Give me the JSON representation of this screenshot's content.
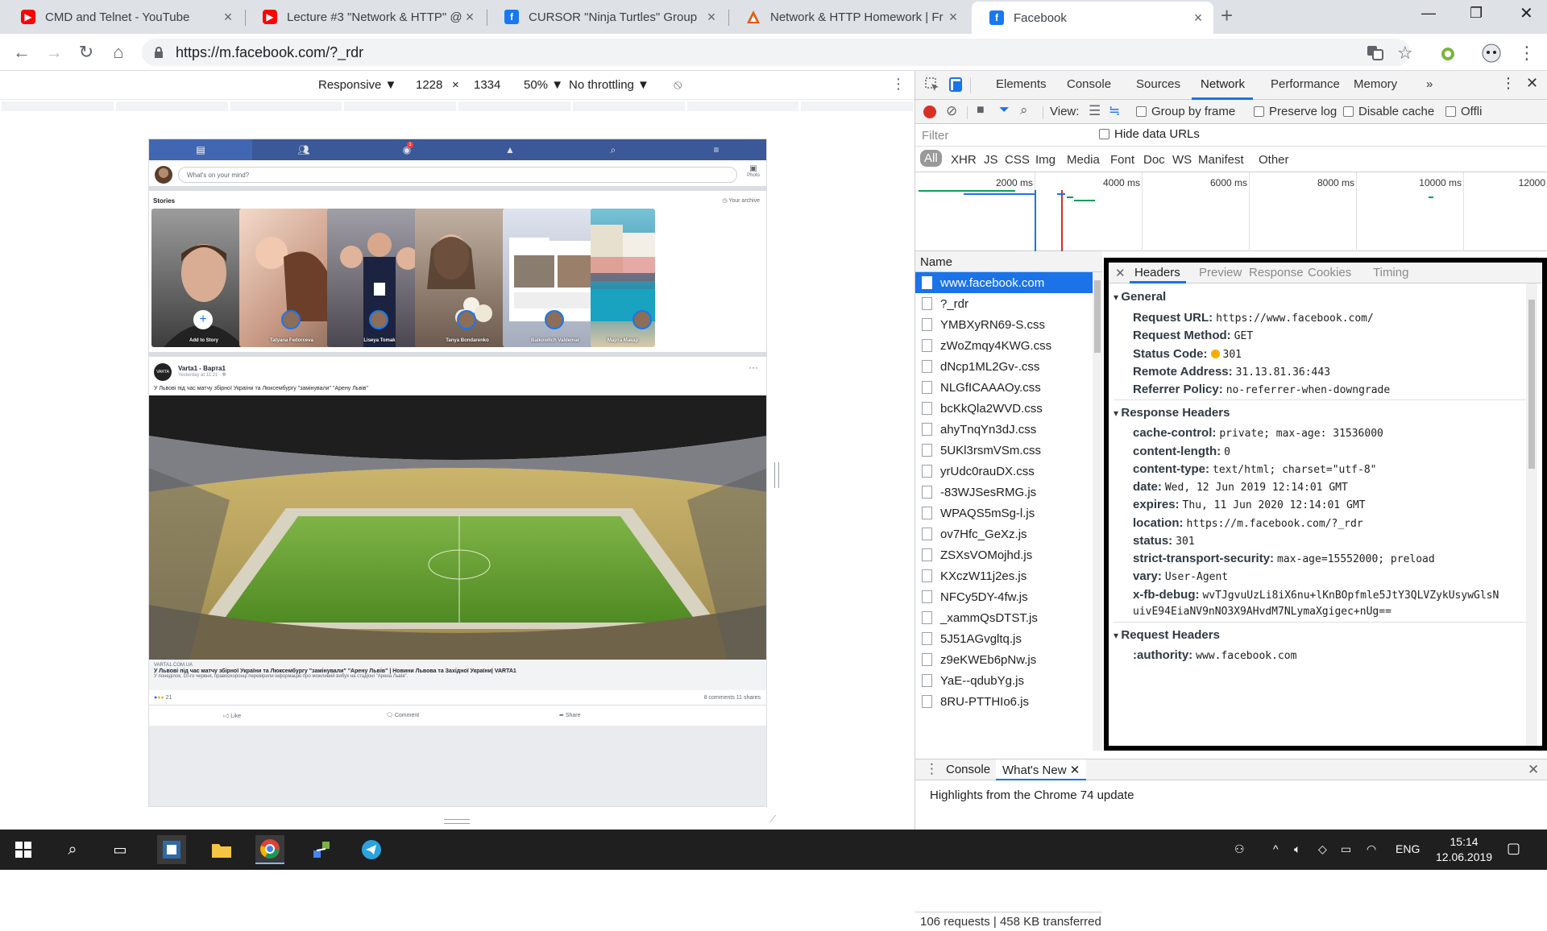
{
  "tabs": [
    {
      "title": "CMD and Telnet - YouTube",
      "favicon": "youtube-icon"
    },
    {
      "title": "Lecture #3 \"Network & HTTP\" @",
      "favicon": "youtube-icon"
    },
    {
      "title": "CURSOR \"Ninja Turtles\" Group",
      "favicon": "facebook-icon"
    },
    {
      "title": "Network & HTTP Homework | Fr",
      "favicon": "warning-triangle-icon"
    },
    {
      "title": "Facebook",
      "favicon": "facebook-icon"
    }
  ],
  "omnibox": {
    "url": "https://m.facebook.com/?_rdr"
  },
  "device_toolbar": {
    "mode": "Responsive ▼",
    "width": "1228",
    "times": "×",
    "height": "1334",
    "zoom": "50% ▼",
    "throttling": "No throttling ▼"
  },
  "fb": {
    "composer_placeholder": "What's on your mind?",
    "photo_label": "Photo",
    "stories_title": "Stories",
    "archive_label": "Your archive",
    "stories": [
      {
        "name": "Add to Story"
      },
      {
        "name": "Tatyana Fedorceva"
      },
      {
        "name": "Liseya Tomak"
      },
      {
        "name": "Tanya Bondarenko"
      },
      {
        "name": "Balkowitch Valdemar"
      },
      {
        "name": "Марта Макар"
      }
    ],
    "post_author": "Varta1 - Варта1",
    "post_time": "Yesterday at 11:21 · ",
    "post_text": "У Львові під час матчу збірної України та Люксембургу \"замінували\" \"Арену Львів\"",
    "link_domain": "VARTA1.COM.UA",
    "link_title": "У Львові під час матчу збірної України та Люксембургу \"замінували\" \"Арену Львів\" | Новини Львова та Західної України| VARTA1",
    "link_desc": "У понеділок, 10-го червня, правоохоронці перевірили інформацію про можливий вибух на стадіоні \"Арена Львів\".",
    "reaction_count": "21",
    "counts": "8 comments   11 shares",
    "like": "Like",
    "comment": "Comment",
    "share": "Share"
  },
  "devtools": {
    "tabs": [
      "Elements",
      "Console",
      "Sources",
      "Network",
      "Performance",
      "Memory",
      "»"
    ],
    "view_label": "View:",
    "group_by_frame": "Group by frame",
    "preserve_log": "Preserve log",
    "disable_cache": "Disable cache",
    "offline": "Offli",
    "filter_placeholder": "Filter",
    "hide_data_urls": "Hide data URLs",
    "types": [
      "All",
      "XHR",
      "JS",
      "CSS",
      "Img",
      "Media",
      "Font",
      "Doc",
      "WS",
      "Manifest",
      "Other"
    ],
    "timeline_labels": [
      "2000 ms",
      "4000 ms",
      "6000 ms",
      "8000 ms",
      "10000 ms",
      "12000"
    ],
    "name_header": "Name",
    "requests": [
      "www.facebook.com",
      "?_rdr",
      "YMBXyRN69-S.css",
      "zWoZmqy4KWG.css",
      "dNcp1ML2Gv-.css",
      "NLGfICAAAOy.css",
      "bcKkQla2WVD.css",
      "ahyTnqYn3dJ.css",
      "5UKl3rsmVSm.css",
      "yrUdc0rauDX.css",
      "-83WJSesRMG.js",
      "WPAQS5mSg-l.js",
      "ov7Hfc_GeXz.js",
      "ZSXsVOMojhd.js",
      "KXczW11j2es.js",
      "NFCy5DY-4fw.js",
      "_xammQsDTST.js",
      "5J51AGvgltq.js",
      "z9eKWEb6pNw.js",
      "YaE--qdubYg.js",
      "8RU-PTTHIo6.js"
    ],
    "summary": "106 requests | 458 KB transferred...",
    "detail_tabs": [
      "Headers",
      "Preview",
      "Response",
      "Cookies",
      "Timing"
    ],
    "general_title": "General",
    "general": [
      {
        "k": "Request URL:",
        "v": "https://www.facebook.com/"
      },
      {
        "k": "Request Method:",
        "v": "GET"
      },
      {
        "k": "Status Code:",
        "v": "301"
      },
      {
        "k": "Remote Address:",
        "v": "31.13.81.36:443"
      },
      {
        "k": "Referrer Policy:",
        "v": "no-referrer-when-downgrade"
      }
    ],
    "response_title": "Response Headers",
    "response": [
      {
        "k": "cache-control:",
        "v": "private; max-age: 31536000"
      },
      {
        "k": "content-length:",
        "v": "0"
      },
      {
        "k": "content-type:",
        "v": "text/html; charset=\"utf-8\""
      },
      {
        "k": "date:",
        "v": "Wed, 12 Jun 2019 12:14:01 GMT"
      },
      {
        "k": "expires:",
        "v": "Thu, 11 Jun 2020 12:14:01 GMT"
      },
      {
        "k": "location:",
        "v": "https://m.facebook.com/?_rdr"
      },
      {
        "k": "status:",
        "v": "301"
      },
      {
        "k": "strict-transport-security:",
        "v": "max-age=15552000; preload"
      },
      {
        "k": "vary:",
        "v": "User-Agent"
      },
      {
        "k": "x-fb-debug:",
        "v": "wvTJgvuUzLi8iX6nu+lKnBOpfmle5JtY3QLVZykUsywGlsN"
      }
    ],
    "xfb_debug_cont": "uivE94EiaNV9nNO3X9AHvdM7NLymaXgigec+nUg==",
    "request_title": "Request Headers",
    "request": [
      {
        "k": ":authority:",
        "v": "www.facebook.com"
      }
    ],
    "drawer_tabs": [
      "Console",
      "What's New"
    ],
    "drawer_text": "Highlights from the Chrome 74 update"
  },
  "taskbar": {
    "lang": "ENG",
    "time": "15:14",
    "date": "12.06.2019"
  },
  "colors": {
    "fb_blue": "#3b5998",
    "selected": "#1a73e8",
    "record": "#d93025"
  }
}
